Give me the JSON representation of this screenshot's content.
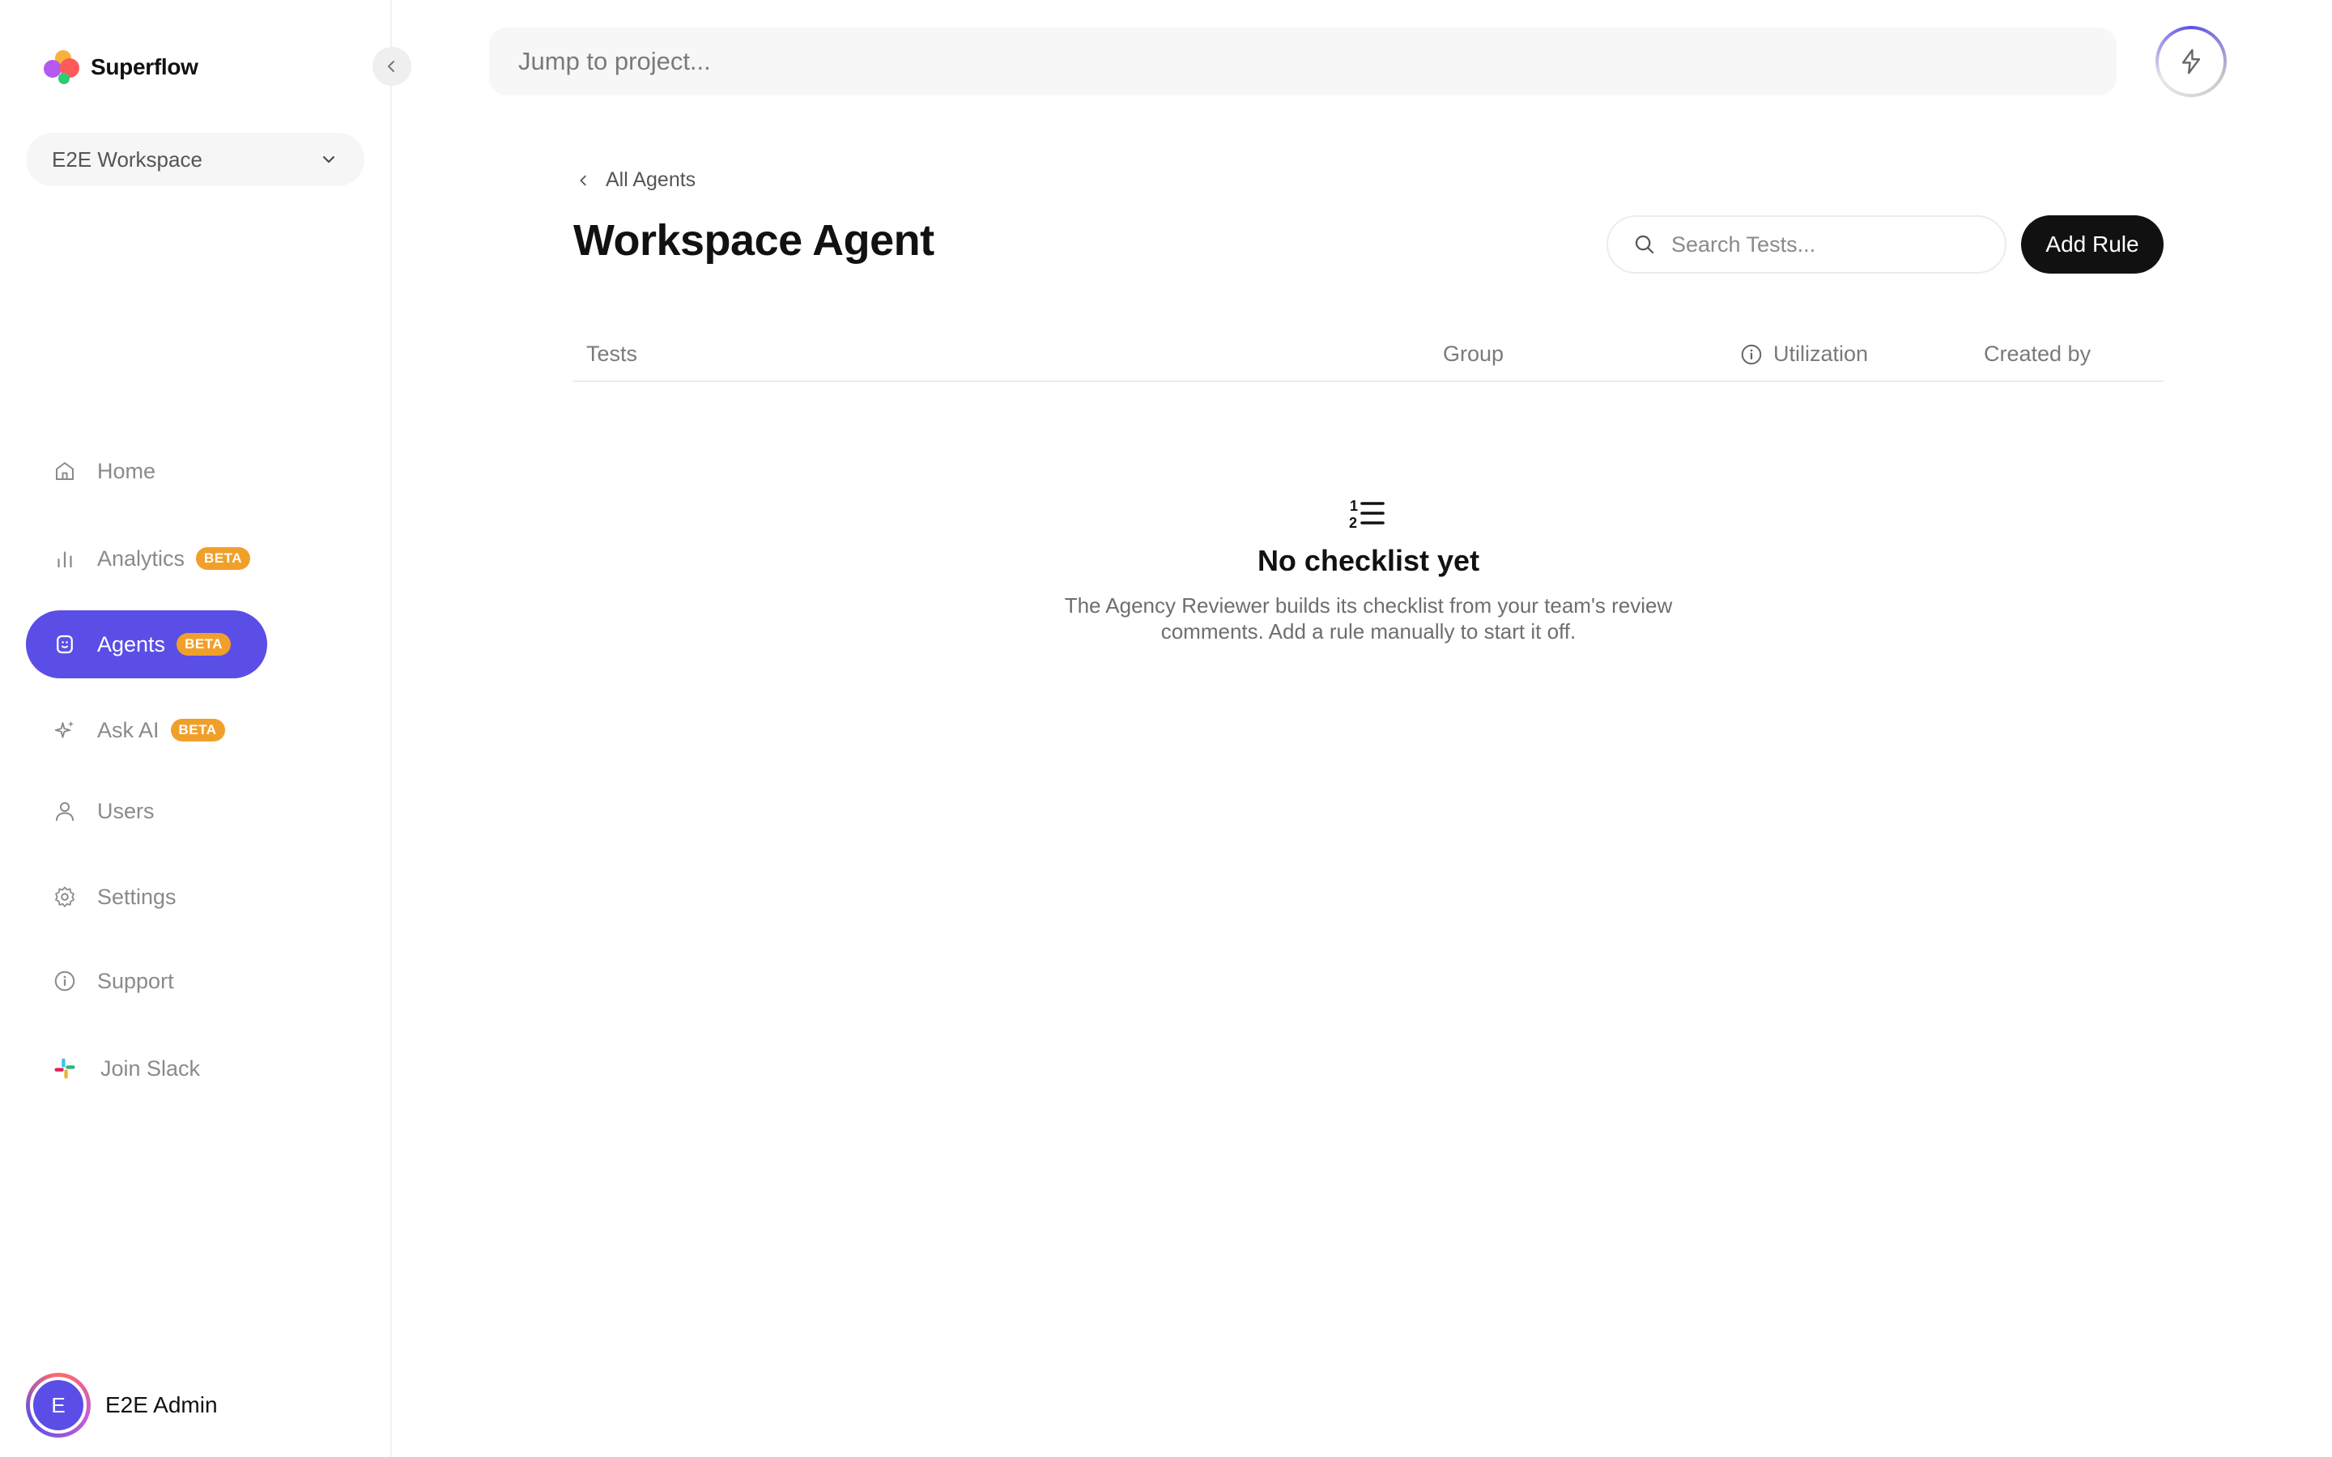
{
  "app": {
    "name": "Superflow",
    "colors": {
      "accent": "#5b4ee6",
      "beta": "#f0a02a",
      "primary_button": "#111111"
    }
  },
  "sidebar": {
    "workspace": "E2E Workspace",
    "items": [
      {
        "label": "Home",
        "icon": "home-icon"
      },
      {
        "label": "Analytics",
        "icon": "bar-chart-icon",
        "badge": "BETA"
      },
      {
        "label": "Agents",
        "icon": "bot-icon",
        "badge": "BETA",
        "active": true
      },
      {
        "label": "Ask AI",
        "icon": "sparkles-icon",
        "badge": "BETA"
      },
      {
        "label": "Users",
        "icon": "user-icon"
      },
      {
        "label": "Settings",
        "icon": "gear-icon"
      },
      {
        "label": "Support",
        "icon": "info-icon"
      },
      {
        "label": "Join Slack",
        "icon": "slack-icon"
      }
    ],
    "user": {
      "initial": "E",
      "name": "E2E Admin"
    }
  },
  "topbar": {
    "search_placeholder": "Jump to project..."
  },
  "main": {
    "breadcrumb": "All Agents",
    "title": "Workspace Agent",
    "search_placeholder": "Search Tests...",
    "add_rule_label": "Add Rule",
    "columns": [
      "Tests",
      "Group",
      "Utilization",
      "Created by"
    ],
    "empty": {
      "title": "No checklist yet",
      "line1": "The Agency Reviewer builds its checklist from your team's review",
      "line2": "comments. Add a rule manually to start it off."
    }
  }
}
